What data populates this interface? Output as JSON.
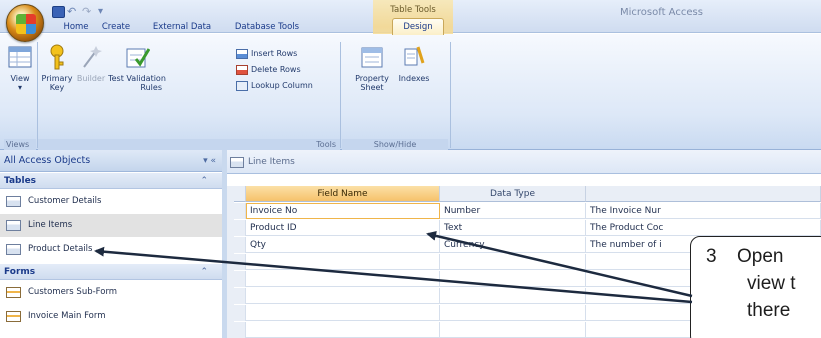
{
  "titlebar": {
    "app_title": "Microsoft Access",
    "contextual_label": "Table Tools",
    "qat": {
      "undo": "↶",
      "redo": "↷",
      "more": "▾"
    }
  },
  "tabs": [
    {
      "label": "Home"
    },
    {
      "label": "Create"
    },
    {
      "label": "External Data"
    },
    {
      "label": "Database Tools"
    },
    {
      "label": "Design"
    }
  ],
  "ribbon": {
    "view": {
      "label": "View",
      "arrow": "▾"
    },
    "primary_key": {
      "line1": "Primary",
      "line2": "Key"
    },
    "builder": {
      "label": "Builder"
    },
    "test_rules": {
      "line1": "Test Validation",
      "line2": "Rules"
    },
    "insert_rows": "Insert Rows",
    "delete_rows": "Delete Rows",
    "lookup_column": "Lookup Column",
    "property_sheet": {
      "line1": "Property",
      "line2": "Sheet"
    },
    "indexes": {
      "label": "Indexes"
    },
    "groups": {
      "views": "Views",
      "tools": "Tools",
      "show_hide": "Show/Hide"
    }
  },
  "nav": {
    "header": "All Access Objects",
    "header_btns": "▾  «",
    "groups": [
      {
        "label": "Tables",
        "chev": "⌃",
        "items": [
          "Customer Details",
          "Line Items",
          "Product Details"
        ]
      },
      {
        "label": "Forms",
        "chev": "⌃",
        "items": [
          "Customers Sub-Form",
          "Invoice Main Form"
        ]
      }
    ]
  },
  "document": {
    "tab_label": "Line Items",
    "headers": {
      "field": "Field Name",
      "type": "Data Type",
      "desc": ""
    },
    "rows": [
      {
        "field": "Invoice No",
        "type": "Number",
        "desc": "The Invoice Nur"
      },
      {
        "field": "Product ID",
        "type": "Text",
        "desc": "The Product Coc"
      },
      {
        "field": "Qty",
        "type": "Currency",
        "desc": "The number of i"
      },
      {
        "field": "",
        "type": "",
        "desc": ""
      },
      {
        "field": "",
        "type": "",
        "desc": ""
      },
      {
        "field": "",
        "type": "",
        "desc": ""
      },
      {
        "field": "",
        "type": "",
        "desc": ""
      },
      {
        "field": "",
        "type": "",
        "desc": ""
      }
    ]
  },
  "callout": {
    "number": "3",
    "line1": "Open",
    "line2": "view t",
    "line3": "there"
  },
  "colors": {
    "accent": "#f6c26b",
    "nav_selected": "#e2e2e2",
    "ribbon": "#dde8f7"
  }
}
